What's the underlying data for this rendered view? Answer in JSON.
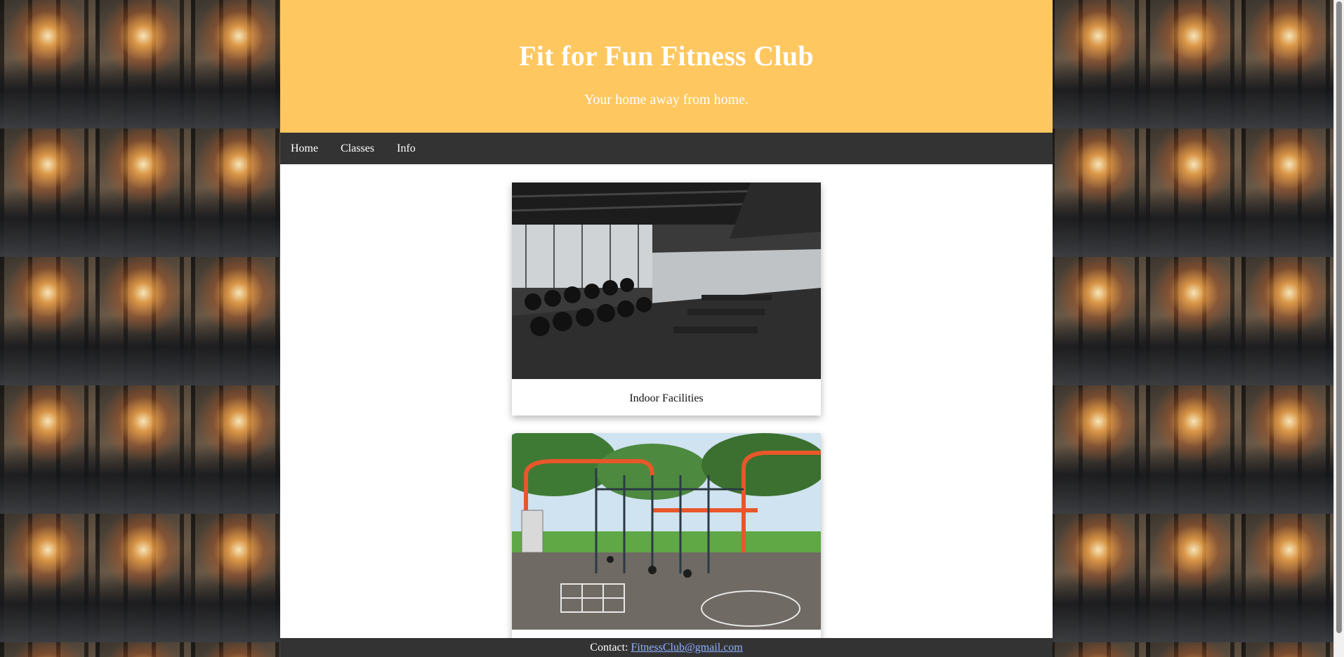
{
  "header": {
    "title": "Fit for Fun Fitness Club",
    "tagline": "Your home away from home."
  },
  "nav": {
    "items": [
      {
        "label": "Home"
      },
      {
        "label": "Classes"
      },
      {
        "label": "Info"
      }
    ]
  },
  "cards": [
    {
      "caption": "Indoor Facilities",
      "image": "indoor-gym-photo"
    },
    {
      "caption": "",
      "image": "outdoor-gym-photo"
    }
  ],
  "footer": {
    "label": "Contact:",
    "email": "FitnessClub@gmail.com"
  },
  "colors": {
    "header_bg": "#ffc760",
    "nav_bg": "#333333",
    "link": "#8fb0ff"
  }
}
